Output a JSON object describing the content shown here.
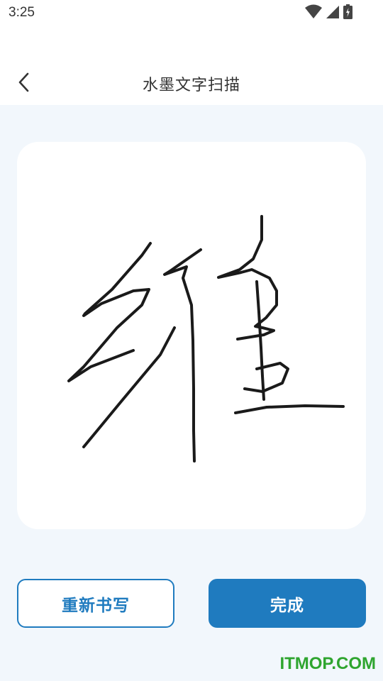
{
  "status_bar": {
    "time": "3:25",
    "icons": [
      "wifi-icon",
      "signal-icon",
      "battery-charging-icon"
    ]
  },
  "header": {
    "back_icon": "chevron-left-icon",
    "title": "水墨文字扫描"
  },
  "canvas": {
    "ink_color": "#1a1a1a"
  },
  "actions": {
    "rewrite_label": "重新书写",
    "done_label": "完成"
  },
  "watermark": "ITMOP.COM",
  "colors": {
    "accent": "#1f7bbf",
    "background": "#f2f7fc",
    "watermark": "#2fa52f"
  }
}
